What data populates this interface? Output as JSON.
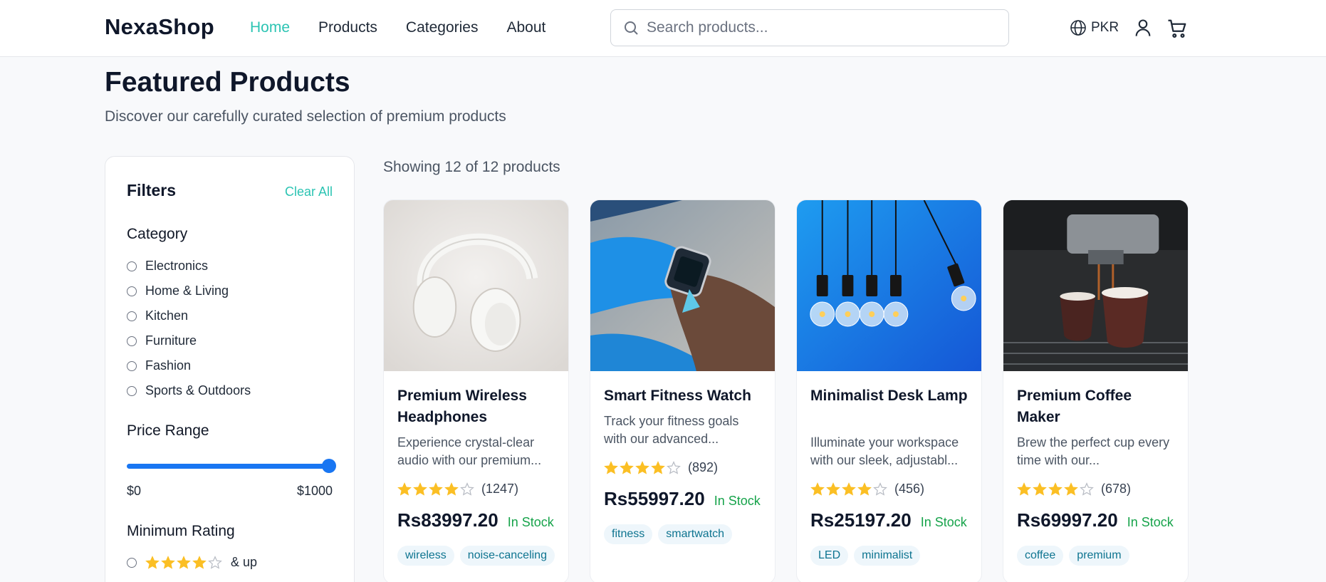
{
  "header": {
    "logo": "NexaShop",
    "nav": [
      {
        "label": "Home",
        "active": true
      },
      {
        "label": "Products",
        "active": false
      },
      {
        "label": "Categories",
        "active": false
      },
      {
        "label": "About",
        "active": false
      }
    ],
    "search_placeholder": "Search products...",
    "currency": "PKR",
    "accent_color": "#2cc4b3"
  },
  "page": {
    "title": "Featured Products",
    "subtitle": "Discover our carefully curated selection of premium products",
    "showing": "Showing 12 of 12 products"
  },
  "filters": {
    "title": "Filters",
    "clear_all": "Clear All",
    "category_title": "Category",
    "categories": [
      "Electronics",
      "Home & Living",
      "Kitchen",
      "Furniture",
      "Fashion",
      "Sports & Outdoors"
    ],
    "price_title": "Price Range",
    "price_min": "$0",
    "price_max": "$1000",
    "price_slider_value": 1000,
    "rating_title": "Minimum Rating",
    "rating_options": [
      {
        "stars": 4,
        "label": "& up"
      }
    ]
  },
  "products": [
    {
      "name": "Premium Wireless Headphones",
      "description": "Experience crystal-clear audio with our premium...",
      "rating": 4,
      "reviews": "(1247)",
      "price": "Rs83997.20",
      "stock": "In Stock",
      "tags": [
        "wireless",
        "noise-canceling"
      ],
      "image": "headphones-photo"
    },
    {
      "name": "Smart Fitness Watch",
      "description": "Track your fitness goals with our advanced...",
      "rating": 4,
      "reviews": "(892)",
      "price": "Rs55997.20",
      "stock": "In Stock",
      "tags": [
        "fitness",
        "smartwatch"
      ],
      "image": "smartwatch-photo"
    },
    {
      "name": "Minimalist Desk Lamp",
      "description": "Illuminate your workspace with our sleek, adjustabl...",
      "rating": 4,
      "reviews": "(456)",
      "price": "Rs25197.20",
      "stock": "In Stock",
      "tags": [
        "LED",
        "minimalist"
      ],
      "image": "light-bulbs-photo"
    },
    {
      "name": "Premium Coffee Maker",
      "description": "Brew the perfect cup every time with our...",
      "rating": 4,
      "reviews": "(678)",
      "price": "Rs69997.20",
      "stock": "In Stock",
      "tags": [
        "coffee",
        "premium"
      ],
      "image": "espresso-photo"
    }
  ]
}
